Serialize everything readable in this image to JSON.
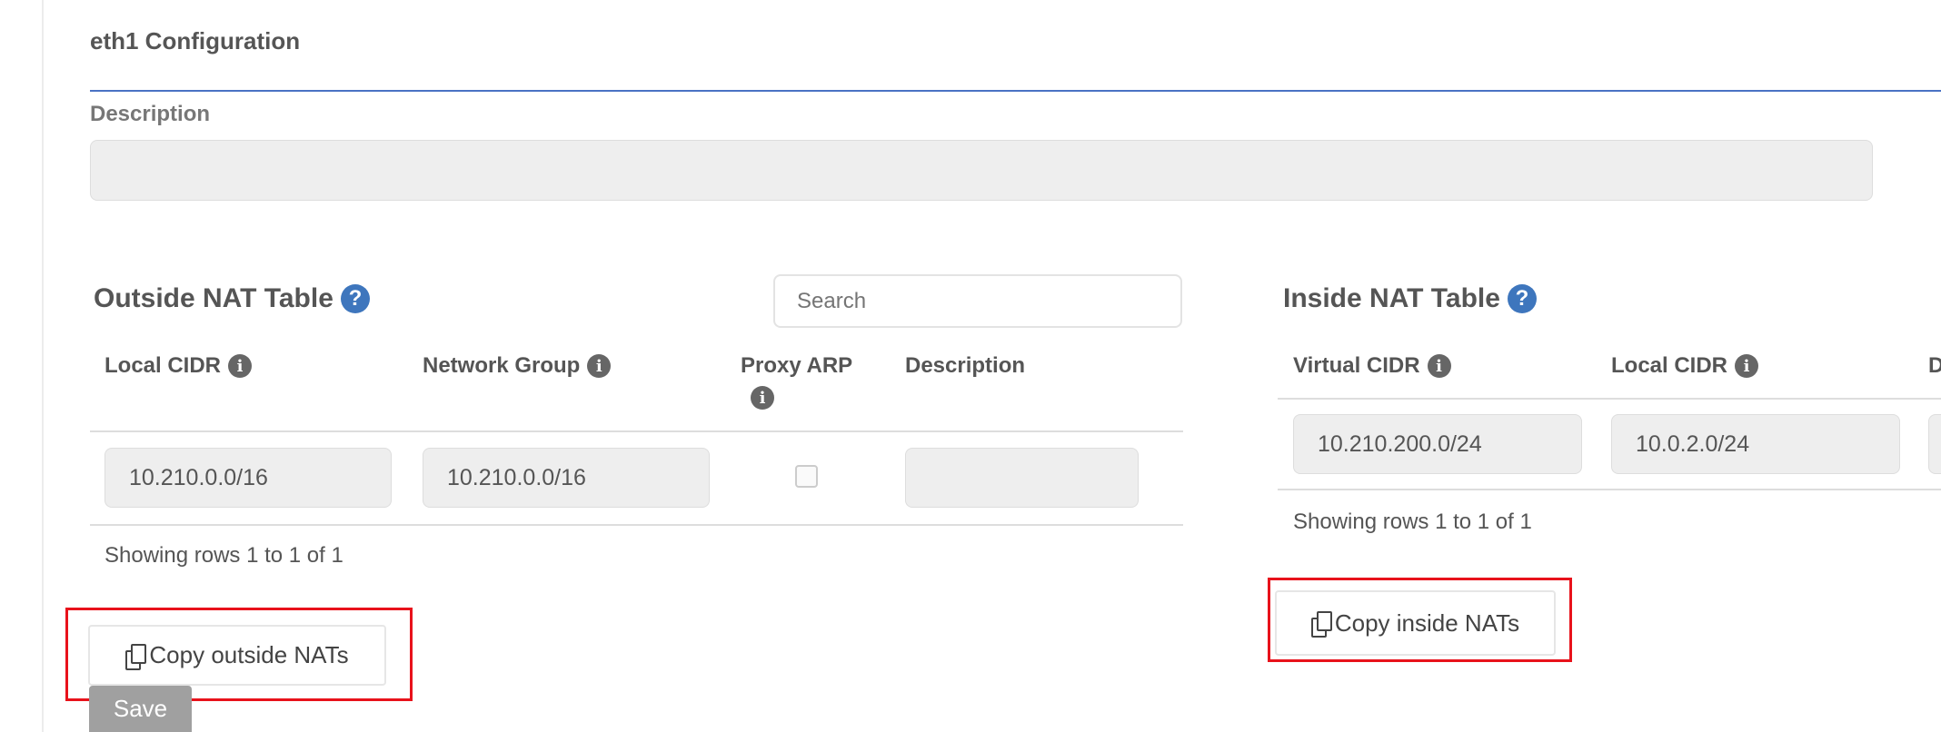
{
  "section_title": "eth1 Configuration",
  "description_label": "Description",
  "description_value": "",
  "outside": {
    "title": "Outside NAT Table",
    "search_placeholder": "Search",
    "columns": [
      "Local CIDR",
      "Network Group",
      "Proxy ARP",
      "Description"
    ],
    "rows": [
      {
        "local_cidr": "10.210.0.0/16",
        "network_group": "10.210.0.0/16",
        "proxy_arp": false,
        "description": ""
      }
    ],
    "footer": "Showing rows 1 to 1 of 1",
    "copy_label": "Copy outside NATs"
  },
  "inside": {
    "title": "Inside NAT Table",
    "columns": [
      "Virtual CIDR",
      "Local CIDR",
      "D"
    ],
    "rows": [
      {
        "virtual_cidr": "10.210.200.0/24",
        "local_cidr": "10.0.2.0/24"
      }
    ],
    "footer": "Showing rows 1 to 1 of 1",
    "copy_label": "Copy inside NATs"
  },
  "save_label": "Save",
  "colors": {
    "accent": "#4a72c4",
    "help": "#3e76bd",
    "highlight": "#e8121b",
    "save": "#a0a0a0"
  }
}
